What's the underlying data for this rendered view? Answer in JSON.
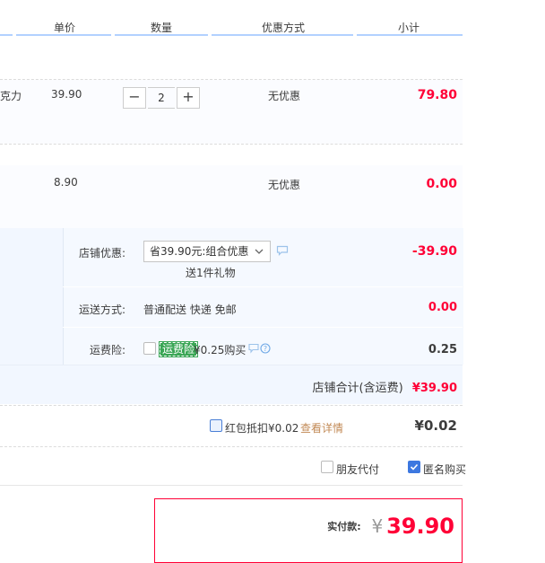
{
  "header": {
    "columns": [
      {
        "key": "unit_price",
        "label": "单价"
      },
      {
        "key": "quantity",
        "label": "数量"
      },
      {
        "key": "promotion",
        "label": "优惠方式"
      },
      {
        "key": "subtotal",
        "label": "小计"
      }
    ]
  },
  "items": [
    {
      "name_tail": "克力",
      "price": "39.90",
      "quantity": "2",
      "promotion": "无优惠",
      "subtotal": "79.80"
    },
    {
      "price": "8.90",
      "promotion": "无优惠",
      "subtotal": "0.00"
    }
  ],
  "stepper": {
    "minus": "−",
    "plus": "+"
  },
  "store": {
    "discount_label": "店铺优惠:",
    "discount_select": "省39.90元:组合优惠",
    "gift_text": "送1件礼物",
    "discount_value": "-39.90",
    "shipping_label": "运送方式:",
    "shipping_method": "普通配送 快递 免邮",
    "shipping_value": "0.00",
    "insurance_label": "运费险:",
    "insurance_tag": "运费险",
    "insurance_price": "¥0.25购买",
    "insurance_value": "0.25",
    "total_label": "店铺合计(含运费)",
    "total_value": "¥39.90"
  },
  "redpacket": {
    "label": "红包抵扣¥0.02",
    "link": "查看详情",
    "value": "¥0.02"
  },
  "options": {
    "friend_pay": "朋友代付",
    "anonymous": "匿名购买"
  },
  "payment": {
    "label": "实付款:",
    "currency": "¥",
    "value": "39.90"
  },
  "colors": {
    "price_red": "#ff0036",
    "header_line": "#b2d1ff",
    "link_orange": "#c28a56"
  }
}
